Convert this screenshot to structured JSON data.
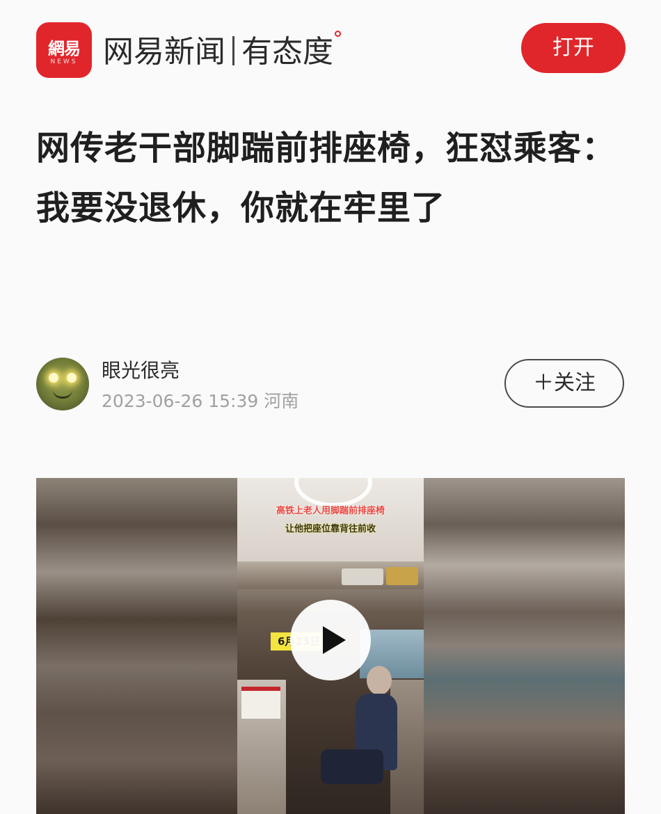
{
  "header": {
    "logo_text": "網易",
    "logo_sub": "NEWS",
    "brand_name": "网易新闻",
    "slogan": "有态度",
    "open_label": "打开",
    "accent_color": "#e0262a"
  },
  "article": {
    "title": "网传老干部脚踹前排座椅，狂怼乘客：我要没退休，你就在牢里了"
  },
  "author": {
    "name": "眼光很亮",
    "timestamp": "2023-06-26 15:39",
    "location": "河南",
    "follow_label": "＋关注"
  },
  "video": {
    "caption_line1": "高铁上老人用脚踹前排座椅",
    "caption_line2": "让他把座位靠背往前收",
    "date_sticker": "6月23日",
    "play_icon": "play-icon"
  }
}
